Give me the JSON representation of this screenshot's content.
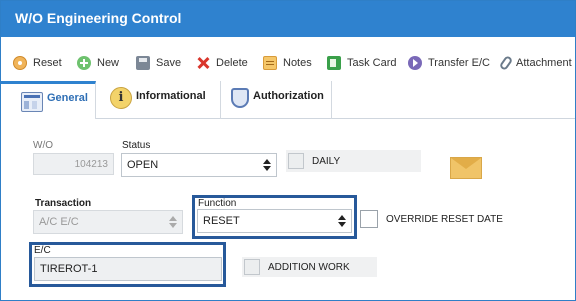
{
  "window": {
    "title": "W/O Engineering Control"
  },
  "toolbar": {
    "items": [
      {
        "label": "Reset",
        "icon": "reset-icon"
      },
      {
        "label": "New",
        "icon": "plus-circle-icon"
      },
      {
        "label": "Save",
        "icon": "floppy-icon"
      },
      {
        "label": "Delete",
        "icon": "x-icon"
      },
      {
        "label": "Notes",
        "icon": "notes-icon"
      },
      {
        "label": "Task Card",
        "icon": "task-card-icon"
      },
      {
        "label": "Transfer E/C",
        "icon": "arrow-circle-icon"
      },
      {
        "label": "Attachment",
        "icon": "paperclip-icon"
      }
    ]
  },
  "tabs": [
    {
      "label": "General",
      "icon": "form-icon",
      "active": true
    },
    {
      "label": "Informational",
      "icon": "info-icon",
      "active": false
    },
    {
      "label": "Authorization",
      "icon": "shield-icon",
      "active": false
    }
  ],
  "form": {
    "wo": {
      "label": "W/O",
      "value": "104213"
    },
    "status": {
      "label": "Status",
      "value": "OPEN"
    },
    "daily": {
      "label": "DAILY",
      "checked": false
    },
    "transaction": {
      "label": "Transaction",
      "value": "A/C E/C"
    },
    "function": {
      "label": "Function",
      "value": "RESET"
    },
    "override_reset_date": {
      "label": "OVERRIDE RESET DATE",
      "checked": false
    },
    "ec": {
      "label": "E/C",
      "value": "TIREROT-1"
    },
    "addition_work": {
      "label": "ADDITION WORK",
      "checked": false
    }
  },
  "colors": {
    "titlebar": "#2f82cf",
    "highlight_border": "#27599a",
    "active_tab": "#2f6fb5"
  }
}
